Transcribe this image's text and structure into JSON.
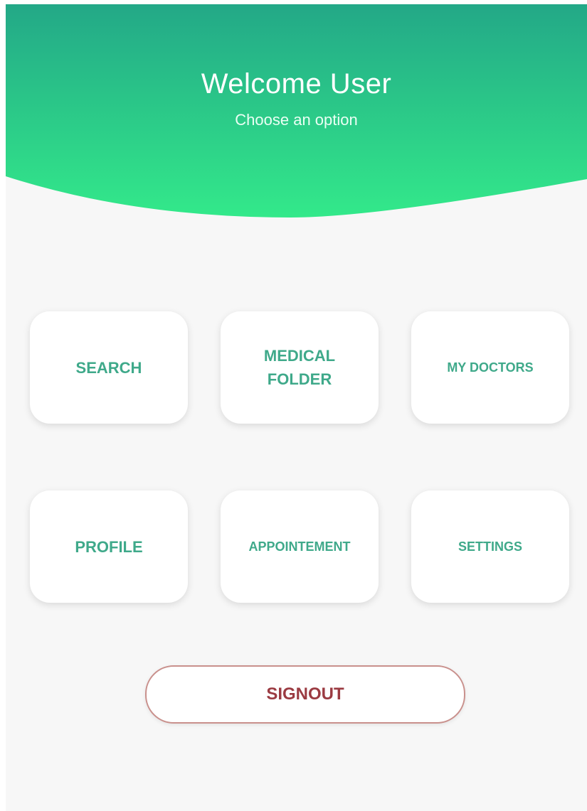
{
  "colors": {
    "header_gradient_top": "#23a887",
    "header_gradient_bottom": "#33e98a",
    "tile_text": "#3fa98a",
    "signout_text": "#9b3b42",
    "signout_border": "#c9908c"
  },
  "header": {
    "title": "Welcome User",
    "subtitle": "Choose an option"
  },
  "menu": {
    "search": "SEARCH",
    "medical_folder_line1": "MEDICAL",
    "medical_folder_line2": "FOLDER",
    "my_doctors": "MY DOCTORS",
    "profile": "PROFILE",
    "appointment": "APPOINTEMENT",
    "settings": "SETTINGS"
  },
  "signout_label": "SIGNOUT"
}
